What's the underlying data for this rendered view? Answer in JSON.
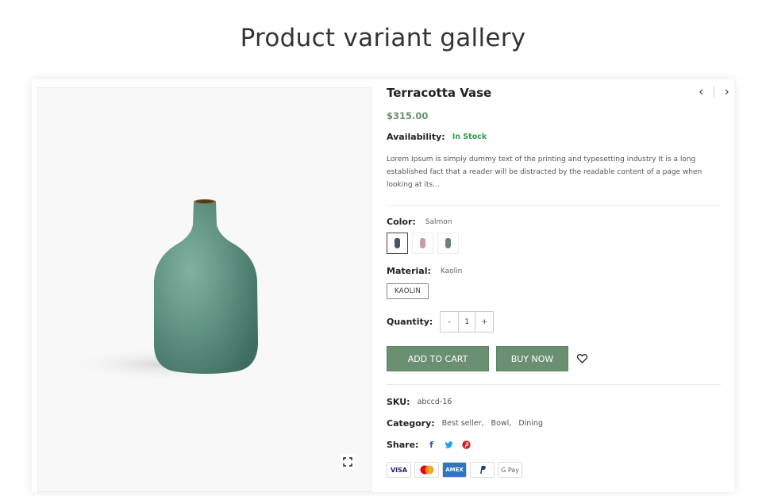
{
  "page": {
    "title": "Product variant gallery"
  },
  "product": {
    "name": "Terracotta Vase",
    "price": "$315.00",
    "availability_label": "Availability:",
    "availability_value": "In Stock",
    "description": "Lorem Ipsum is simply dummy text of the printing and typesetting industry It is a long established fact that a reader will be distracted by the readable content of a page when looking at its...",
    "color_label": "Color:",
    "color_value": "Salmon",
    "color_swatches": [
      {
        "name": "Dark slate",
        "color": "#4a5560"
      },
      {
        "name": "Pink",
        "color": "#c99aa8"
      },
      {
        "name": "Grey green",
        "color": "#6f7f7c"
      }
    ],
    "material_label": "Material:",
    "material_value": "Kaolin",
    "material_option": "KAOLIN",
    "quantity_label": "Quantity:",
    "quantity_minus": "-",
    "quantity_value": "1",
    "quantity_plus": "+",
    "add_to_cart": "ADD TO CART",
    "buy_now": "BUY NOW",
    "sku_label": "SKU:",
    "sku_value": "abccd-16",
    "category_label": "Category:",
    "categories": [
      "Best seller,",
      "Bowl,",
      "Dining"
    ],
    "share_label": "Share:",
    "share_icons": [
      "facebook-icon",
      "twitter-icon",
      "pinterest-icon"
    ],
    "payment_methods": [
      "VISA",
      "Mastercard",
      "AMEX",
      "PayPal",
      "G Pay"
    ]
  },
  "colors": {
    "accent": "#6b8f71",
    "in_stock": "#2e9e4a",
    "vase": "#5f9282"
  }
}
